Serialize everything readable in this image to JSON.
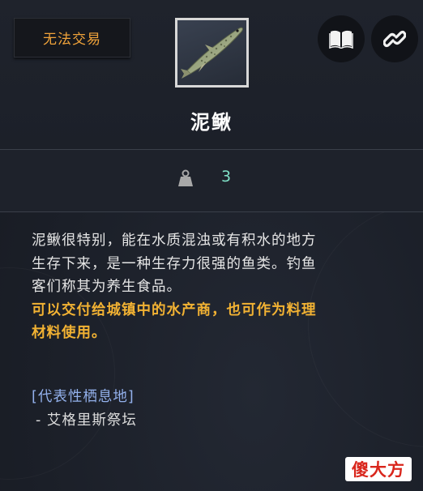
{
  "item": {
    "trade_status": "无法交易",
    "name": "泥鳅",
    "level": "3",
    "icon": "loach-fish-icon"
  },
  "actions": {
    "book_icon": "book-icon",
    "link_icon": "link-icon"
  },
  "description": {
    "lines": [
      "泥鳅很特别，能在水质混浊或有积水的地方",
      "生存下来，是一种生存力很强的鱼类。钓鱼",
      "客们称其为养生食品。"
    ],
    "highlight_lines": [
      "可以交付给城镇中的水产商，也可作为料理",
      "材料使用。"
    ]
  },
  "habitat": {
    "title": "[代表性栖息地]",
    "items": [
      "- 艾格里斯祭坛"
    ]
  },
  "watermark": "傻大方",
  "colors": {
    "trade_status": "#f0a33a",
    "level": "#7fe0c6",
    "highlight": "#f2b233",
    "habitat_title": "#93b1ec"
  }
}
